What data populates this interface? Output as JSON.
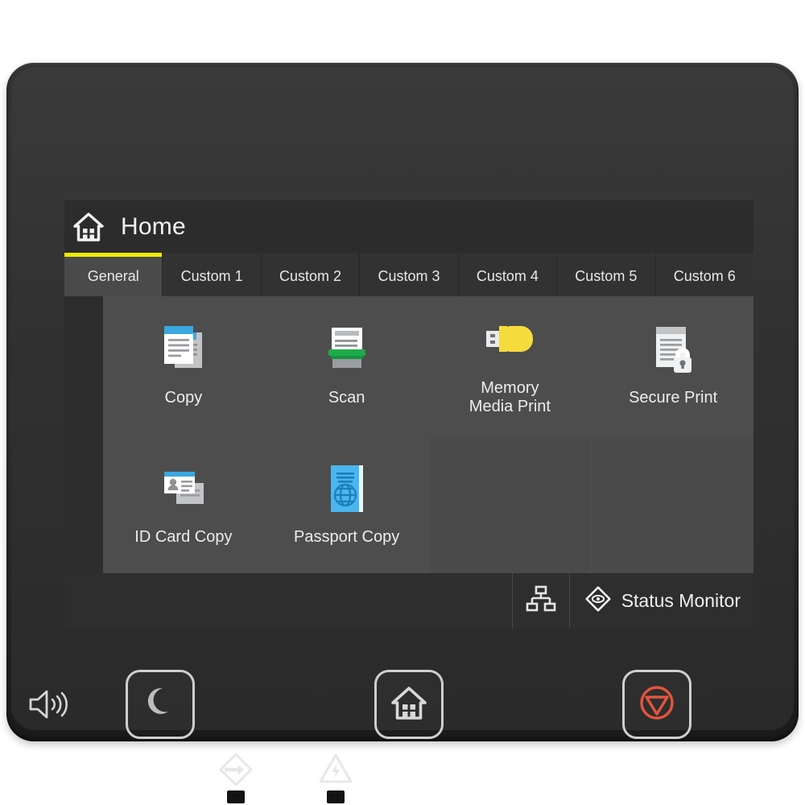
{
  "device": {
    "name": "printer-control-panel",
    "bezel_color": "#2e2e2e",
    "screen_background": "#2d2d2d"
  },
  "screen": {
    "title": "Home",
    "title_icon": "home-icon",
    "accent_color": "#eeea00",
    "tabs": [
      {
        "label": "General",
        "active": true
      },
      {
        "label": "Custom 1",
        "active": false
      },
      {
        "label": "Custom 2",
        "active": false
      },
      {
        "label": "Custom 3",
        "active": false
      },
      {
        "label": "Custom 4",
        "active": false
      },
      {
        "label": "Custom 5",
        "active": false
      },
      {
        "label": "Custom 6",
        "active": false
      }
    ],
    "tiles": [
      {
        "label": "Copy",
        "icon": "copy-documents-icon",
        "accent": "#3ba7e0"
      },
      {
        "label": "Scan",
        "icon": "scanner-icon",
        "accent": "#1eaa4b"
      },
      {
        "label": "Memory\nMedia Print",
        "icon": "usb-flash-drive-icon",
        "accent": "#f5dc3c"
      },
      {
        "label": "Secure Print",
        "icon": "document-lock-icon",
        "accent": "#d8d8d8"
      },
      {
        "label": "ID Card Copy",
        "icon": "id-card-icon",
        "accent": "#3ba7e0"
      },
      {
        "label": "Passport Copy",
        "icon": "passport-book-icon",
        "accent": "#4ab5ee"
      },
      {
        "label": "",
        "icon": "",
        "accent": ""
      },
      {
        "label": "",
        "icon": "",
        "accent": ""
      }
    ],
    "status_bar": {
      "lan_icon": "network-lan-icon",
      "status_monitor_icon": "status-monitor-eye-icon",
      "status_monitor_label": "Status Monitor"
    }
  },
  "hardware": {
    "speaker_icon": "speaker-volume-icon",
    "buttons": [
      {
        "name": "energy-saver-button",
        "icon": "crescent-moon-icon",
        "color": "#bdbdbd"
      },
      {
        "name": "home-button",
        "icon": "home-house-icon",
        "color": "#d8d8d8"
      },
      {
        "name": "stop-button",
        "icon": "stop-triangle-icon",
        "color": "#e2543f"
      }
    ],
    "indicators": [
      {
        "name": "data-indicator",
        "icon": "data-arrow-icon"
      },
      {
        "name": "error-indicator",
        "icon": "error-warning-icon"
      }
    ]
  }
}
